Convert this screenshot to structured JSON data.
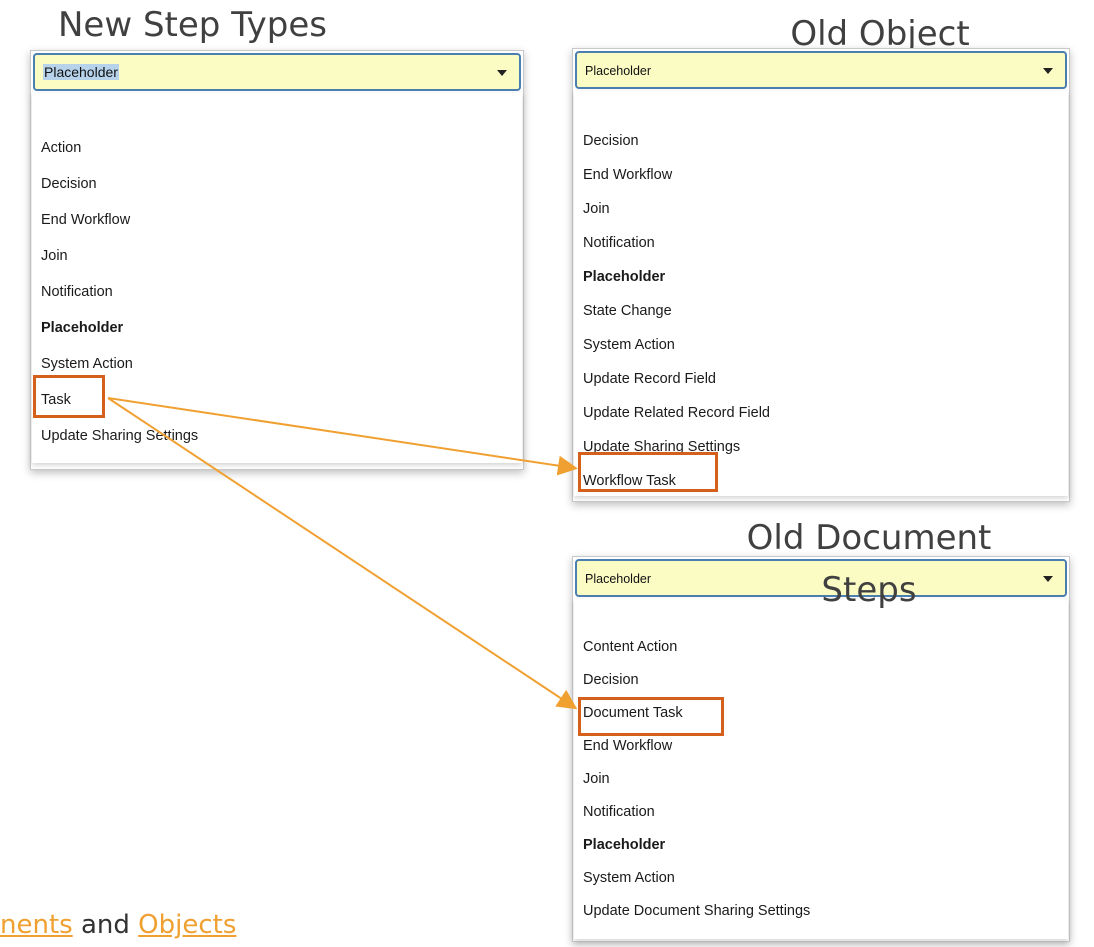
{
  "headings": {
    "new": "New Step Types",
    "old_object": "Old Object Steps",
    "old_document": "Old Document Steps"
  },
  "new_steps": {
    "selected": "Placeholder",
    "options": [
      "Action",
      "Decision",
      "End Workflow",
      "Join",
      "Notification",
      "Placeholder",
      "System Action",
      "Task",
      "Update Sharing Settings"
    ]
  },
  "object_steps": {
    "selected": "Placeholder",
    "options": [
      "Decision",
      "End Workflow",
      "Join",
      "Notification",
      "Placeholder",
      "State Change",
      "System Action",
      "Update Record Field",
      "Update Related Record Field",
      "Update Sharing Settings",
      "Workflow Task"
    ]
  },
  "document_steps": {
    "selected": "Placeholder",
    "options": [
      "Content Action",
      "Decision",
      "Document Task",
      "End Workflow",
      "Join",
      "Notification",
      "Placeholder",
      "System Action",
      "Update Document Sharing Settings"
    ]
  },
  "footer": {
    "link1": "nents",
    "middle": " and ",
    "link2": "Objects"
  },
  "colors": {
    "highlight_box": "#d4601c",
    "arrow": "#f0a030",
    "select_bg": "#fbfbc4"
  }
}
